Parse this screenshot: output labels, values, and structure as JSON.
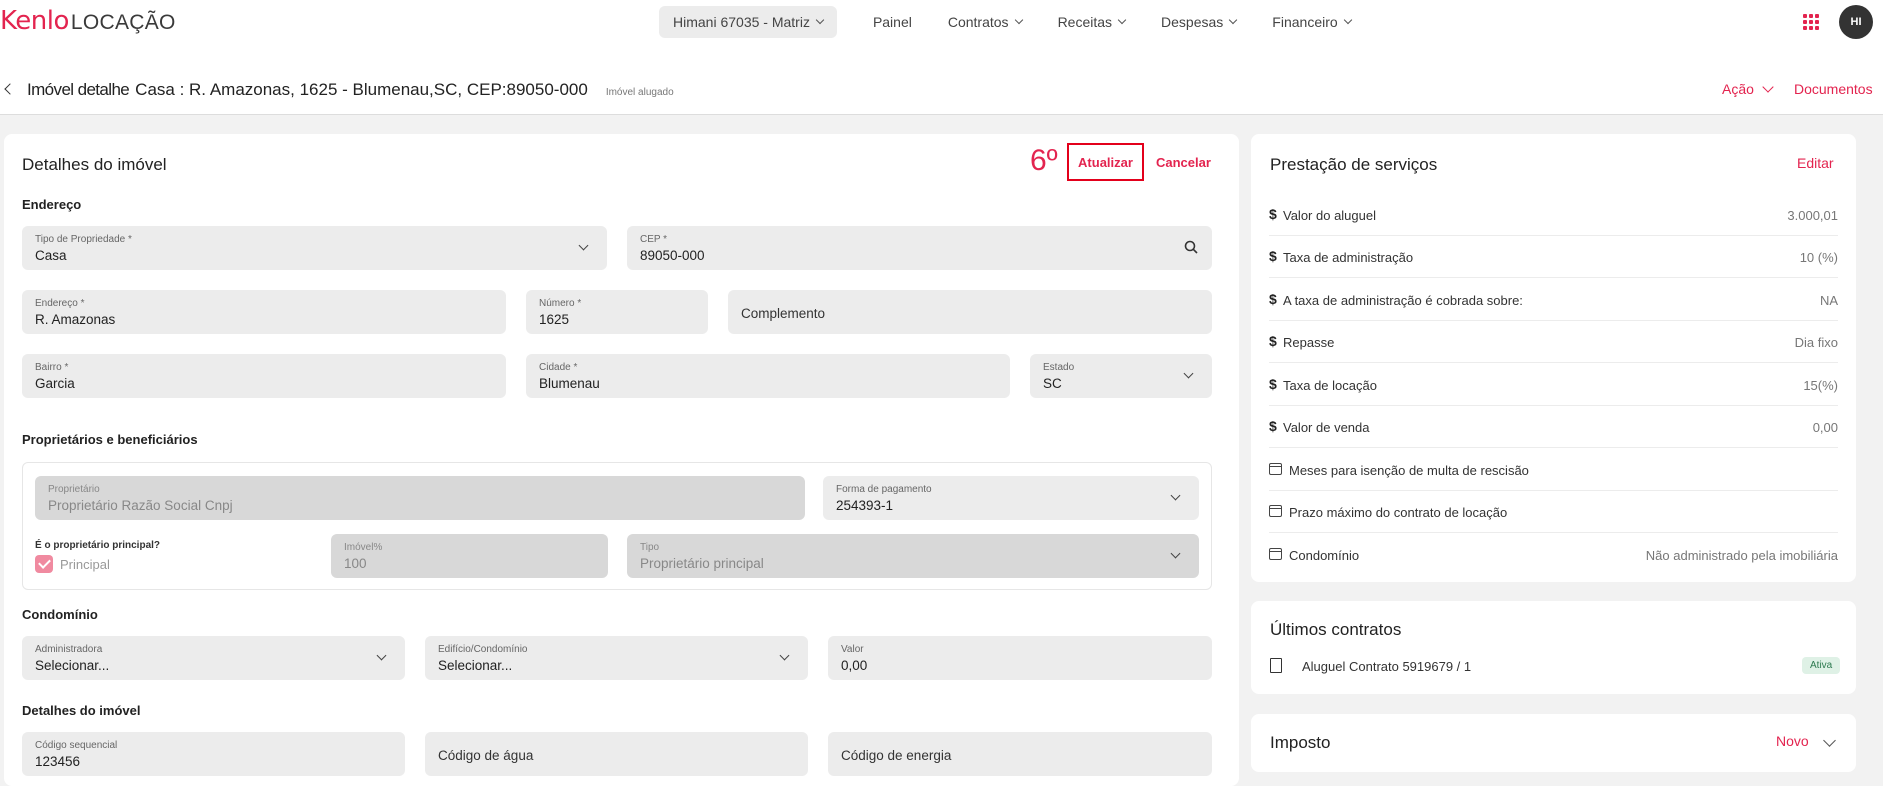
{
  "topnav": {
    "brand": "Kenlo",
    "product": "LOCAÇÃO",
    "branch": "Himani 67035 - Matriz",
    "items": [
      {
        "label": "Painel",
        "has_menu": false
      },
      {
        "label": "Contratos",
        "has_menu": true
      },
      {
        "label": "Receitas",
        "has_menu": true
      },
      {
        "label": "Despesas",
        "has_menu": true
      },
      {
        "label": "Financeiro",
        "has_menu": true
      }
    ],
    "avatar_initials": "HI",
    "accent": "#e3244f"
  },
  "header": {
    "title": "Imóvel detalhe",
    "subtitle": "Casa : R. Amazonas, 1625 - Blumenau,SC, CEP:89050-000",
    "badge": "Imóvel alugado",
    "acao": "Ação",
    "documentos": "Documentos"
  },
  "details": {
    "title": "Detalhes do imóvel",
    "step_marker": "6º",
    "atualizar": "Atualizar",
    "cancelar": "Cancelar",
    "section_endereco": "Endereço",
    "fields": {
      "tipo": {
        "label": "Tipo de Propriedade *",
        "value": "Casa"
      },
      "cep": {
        "label": "CEP *",
        "value": "89050-000"
      },
      "endereco": {
        "label": "Endereço *",
        "value": "R. Amazonas"
      },
      "numero": {
        "label": "Número *",
        "value": "1625"
      },
      "complemento": {
        "placeholder": "Complemento"
      },
      "bairro": {
        "label": "Bairro *",
        "value": "Garcia"
      },
      "cidade": {
        "label": "Cidade *",
        "value": "Blumenau"
      },
      "estado": {
        "label": "Estado",
        "value": "SC"
      }
    },
    "section_owners": "Proprietários e beneficiários",
    "owner": {
      "proprietario": {
        "label": "Proprietário",
        "value": "Proprietário Razão Social Cnpj"
      },
      "forma_pagamento": {
        "label": "Forma de pagamento",
        "value": "254393-1"
      },
      "principal_q": "É o proprietário principal?",
      "principal_label": "Principal",
      "principal_checked": true,
      "imovel_pct": {
        "label": "Imóvel%",
        "value": "100"
      },
      "tipo": {
        "label": "Tipo",
        "value": "Proprietário principal"
      }
    },
    "section_condominio": "Condomínio",
    "condominio": {
      "administradora": {
        "label": "Administradora",
        "value": "Selecionar..."
      },
      "edificio": {
        "label": "Edifício/Condomínio",
        "value": "Selecionar..."
      },
      "valor": {
        "label": "Valor",
        "value": "0,00"
      }
    },
    "section_detalhes": "Detalhes do imóvel",
    "detalhes": {
      "codigo_seq": {
        "label": "Código sequencial",
        "value": "123456"
      },
      "codigo_agua": {
        "placeholder": "Código de água"
      },
      "codigo_energia": {
        "placeholder": "Código de energia"
      }
    }
  },
  "services": {
    "title": "Prestação de serviços",
    "edit": "Editar",
    "rows": [
      {
        "icon": "dollar-icon",
        "label": "Valor do aluguel",
        "value": "3.000,01"
      },
      {
        "icon": "dollar-icon",
        "label": "Taxa de administração",
        "value": "10 (%)"
      },
      {
        "icon": "dollar-icon",
        "label": "A taxa de administração é cobrada sobre:",
        "value": "NA"
      },
      {
        "icon": "dollar-icon",
        "label": "Repasse",
        "value": "Dia fixo"
      },
      {
        "icon": "dollar-icon",
        "label": "Taxa de locação",
        "value": "15(%)"
      },
      {
        "icon": "dollar-icon",
        "label": "Valor de venda",
        "value": "0,00"
      },
      {
        "icon": "calendar-icon",
        "label": "Meses para isenção de multa de rescisão",
        "value": ""
      },
      {
        "icon": "calendar-icon",
        "label": "Prazo máximo do contrato de locação",
        "value": ""
      },
      {
        "icon": "calendar-icon",
        "label": "Condomínio",
        "value": "Não administrado pela imobiliária"
      }
    ]
  },
  "contracts": {
    "title": "Últimos contratos",
    "item": "Aluguel Contrato 5919679 / 1",
    "status": "Ativa"
  },
  "tax": {
    "title": "Imposto",
    "novo": "Novo"
  }
}
